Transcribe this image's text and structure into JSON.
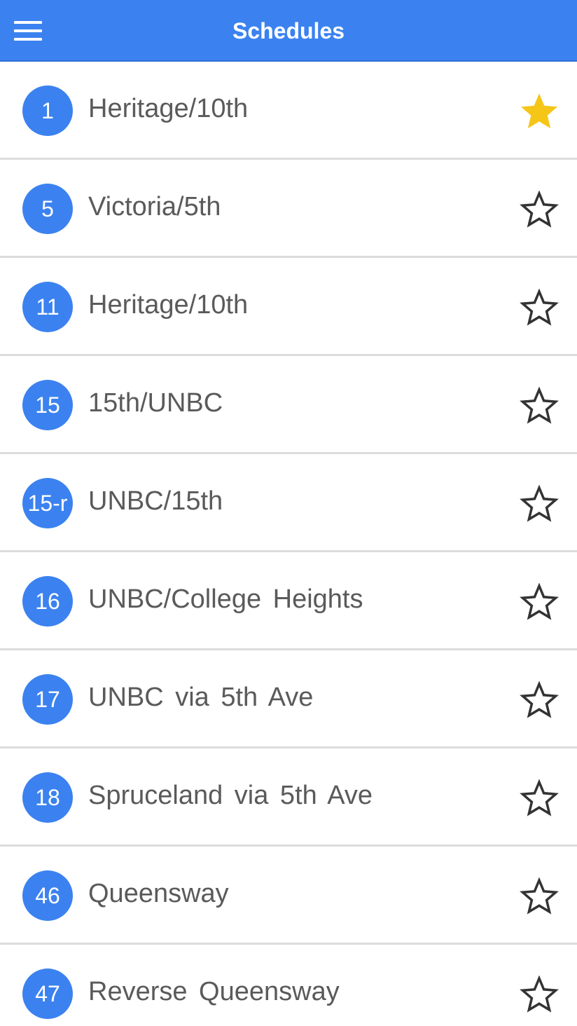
{
  "header": {
    "title": "Schedules",
    "menu_icon": "hamburger-menu-icon",
    "color": "#3b82f0"
  },
  "routes": [
    {
      "number": "1",
      "name": "Heritage/10th",
      "favorite": true
    },
    {
      "number": "5",
      "name": "Victoria/5th",
      "favorite": false
    },
    {
      "number": "11",
      "name": "Heritage/10th",
      "favorite": false
    },
    {
      "number": "15",
      "name": "15th/UNBC",
      "favorite": false
    },
    {
      "number": "15-r",
      "name": "UNBC/15th",
      "favorite": false
    },
    {
      "number": "16",
      "name": "UNBC/College Heights",
      "favorite": false
    },
    {
      "number": "17",
      "name": "UNBC via 5th Ave",
      "favorite": false
    },
    {
      "number": "18",
      "name": "Spruceland via 5th Ave",
      "favorite": false
    },
    {
      "number": "46",
      "name": "Queensway",
      "favorite": false
    },
    {
      "number": "47",
      "name": "Reverse Queensway",
      "favorite": false
    }
  ],
  "colors": {
    "badge": "#3b82f0",
    "star_filled": "#f5c518",
    "star_outline": "#333333",
    "divider": "#dcdcdc"
  }
}
